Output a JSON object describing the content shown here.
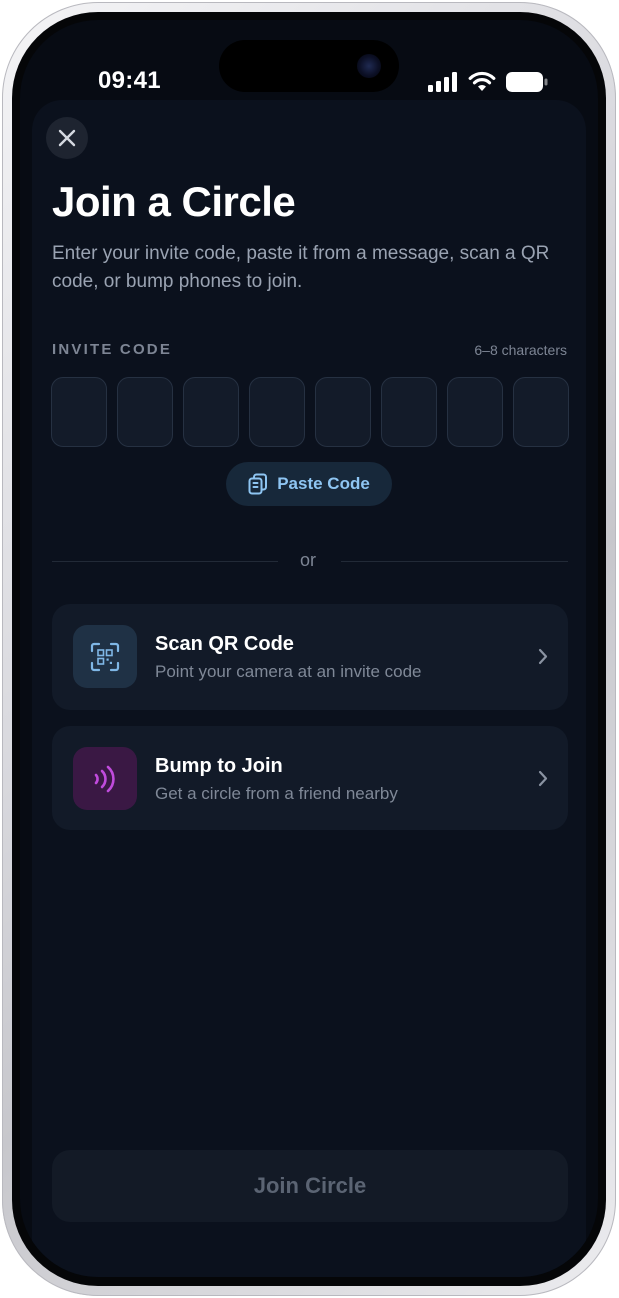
{
  "status_bar": {
    "time": "09:41"
  },
  "sheet": {
    "title": "Join a Circle",
    "subtitle": "Enter your invite code, paste it from a message, scan a QR code, or bump phones to join.",
    "invite": {
      "label": "INVITE CODE",
      "hint": "6–8 characters",
      "boxes": [
        "",
        "",
        "",
        "",
        "",
        "",
        "",
        ""
      ]
    },
    "paste_button": "Paste Code",
    "divider_text": "or",
    "options": [
      {
        "title": "Scan QR Code",
        "subtitle": "Point your camera at an invite code",
        "icon": "qr-scan-icon"
      },
      {
        "title": "Bump to Join",
        "subtitle": "Get a circle from a friend nearby",
        "icon": "nfc-waves-icon"
      }
    ],
    "join_button": "Join Circle"
  },
  "colors": {
    "background": "#070b13",
    "sheet": "#0b111d",
    "accent_blue": "#8ec5f2",
    "accent_purple": "#c04bdc",
    "disabled_text": "#5b6473"
  }
}
